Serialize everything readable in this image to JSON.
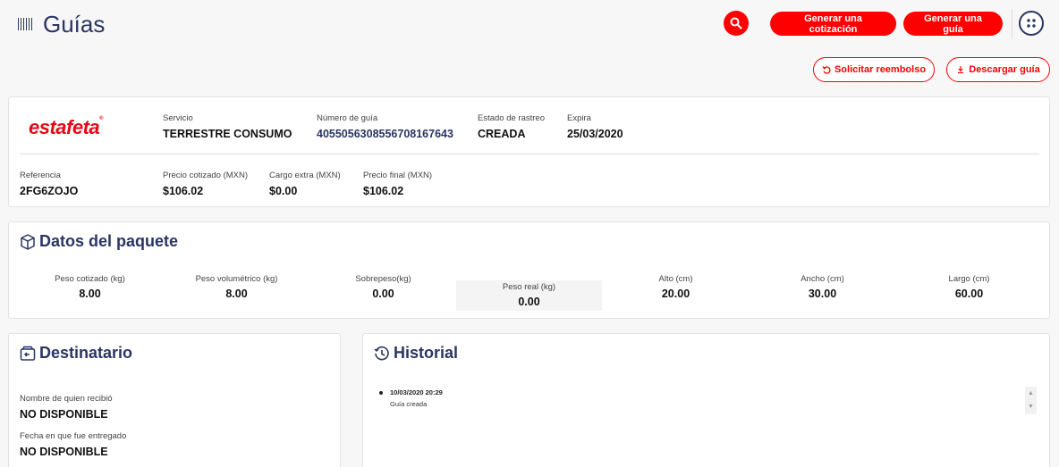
{
  "header": {
    "title": "Guías",
    "quote_button": "Generar una cotización",
    "guide_button": "Generar una guía",
    "refund_button": "Solicitar reembolso",
    "download_button": "Descargar guía",
    "icons": {
      "title": "barcode-icon",
      "search": "search-icon",
      "apps": "apps-grid-icon",
      "refund": "undo-icon",
      "download": "download-icon"
    }
  },
  "shipment": {
    "carrier_logo": "estafeta",
    "service_label": "Servicio",
    "service_value": "TERRESTRE CONSUMO",
    "tracking_label": "Número de guía",
    "tracking_value": "405505630855670816764 3",
    "status_label": "Estado de rastreo",
    "status_value": "CREADA",
    "expires_label": "Expira",
    "expires_value": "25/03/2020",
    "reference_label": "Referencia",
    "reference_value": "2FG6ZOJO",
    "quoted_price_label": "Precio cotizado (MXN)",
    "quoted_price_value": "$106.02",
    "extra_charge_label": "Cargo extra (MXN)",
    "extra_charge_value": "$0.00",
    "final_price_label": "Precio final (MXN)",
    "final_price_value": "$106.02"
  },
  "package": {
    "title": "Datos del paquete",
    "icon": "package-icon",
    "metrics": [
      {
        "label": "Peso cotizado (kg)",
        "value": "8.00"
      },
      {
        "label": "Peso volumétrico (kg)",
        "value": "8.00"
      },
      {
        "label": "Sobrepeso(kg)",
        "value": "0.00"
      },
      {
        "label": "Peso real (kg)",
        "value": "0.00"
      },
      {
        "label": "Alto (cm)",
        "value": "20.00"
      },
      {
        "label": "Ancho (cm)",
        "value": "30.00"
      },
      {
        "label": "Largo (cm)",
        "value": "60.00"
      }
    ]
  },
  "recipient": {
    "title": "Destinatario",
    "icon": "inbox-icon",
    "received_by_label": "Nombre de quien recibió",
    "received_by_value": "NO DISPONIBLE",
    "delivered_date_label": "Fecha en que fue entregado",
    "delivered_date_value": "NO DISPONIBLE"
  },
  "history": {
    "title": "Historial",
    "icon": "history-icon",
    "items": [
      {
        "date": "10/03/2020 20:29",
        "description": "Guía creada"
      }
    ]
  },
  "colors": {
    "brand_red": "#ff0000",
    "navy": "#2a3563",
    "estafeta_red": "#e10a17"
  }
}
